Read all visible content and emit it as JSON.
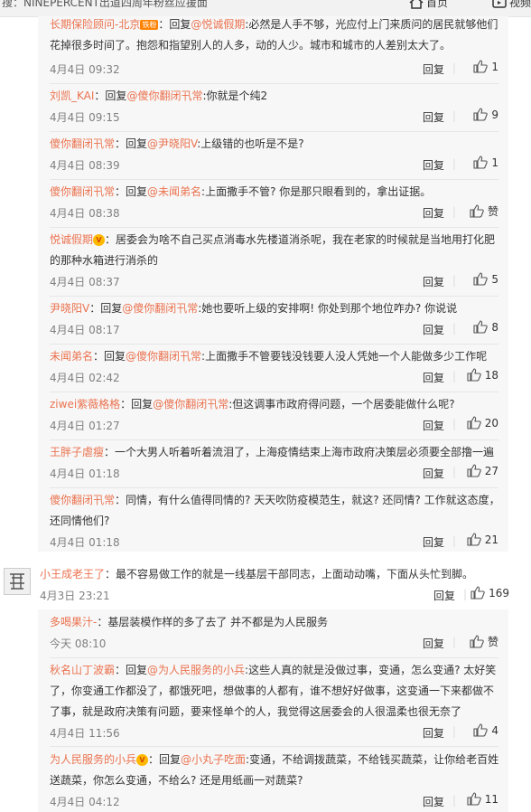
{
  "topbar": {
    "search": "搜：NINEPERCENT出道四周年粉丝应援面",
    "home": "首页",
    "video": "视频"
  },
  "thread1": [
    {
      "name": "长期保险顾问-北京",
      "badge": "铁粉",
      "prefix": "：回复",
      "mention": "@悦诚假期",
      "text": ":必然是人手不够，光应付上门来质问的居民就够他们花掉很多时间了。抱怨和指望别人的人多，动的人少。城市和城市的人差别太大了。",
      "time": "4月4日 09:32",
      "reply": "回复",
      "likes": "1"
    },
    {
      "name": "刘凯_KAI",
      "prefix": "：回复",
      "mention": "@傻你翻闭卂常",
      "text": ":你就是个纯2",
      "time": "4月4日 09:15",
      "reply": "回复",
      "likes": "9"
    },
    {
      "name": "傻你翻闭卂常",
      "prefix": "：回复",
      "mention": "@尹晓阳V",
      "text": ":上级错的也听是不是?",
      "time": "4月4日 08:39",
      "reply": "回复",
      "likes": "1"
    },
    {
      "name": "傻你翻闭卂常",
      "prefix": "：回复",
      "mention": "@未闻弟名",
      "text": ":上面撒手不管? 你是那只眼看到的，拿出证据。",
      "time": "4月4日 08:38",
      "reply": "回复",
      "likes": "赞"
    },
    {
      "name": "悦诚假期",
      "crown": "V",
      "prefix": "：",
      "mention": "",
      "text": "居委会为啥不自己买点消毒水先楼道消杀呢，我在老家的时候就是当地用打化肥的那种水箱进行消杀的",
      "time": "4月4日 08:37",
      "reply": "回复",
      "likes": "5"
    },
    {
      "name": "尹晓阳V",
      "prefix": "：回复",
      "mention": "@傻你翻闭卂常",
      "text": ":她也要听上级的安排啊! 你处到那个地位咋办? 你说说",
      "time": "4月4日 08:17",
      "reply": "回复",
      "likes": "8"
    },
    {
      "name": "未闻弟名",
      "prefix": "：回复",
      "mention": "@傻你翻闭卂常",
      "text": ":上面撒手不管要钱没钱要人没人凭她一个人能做多少工作呢",
      "time": "4月4日 02:42",
      "reply": "回复",
      "likes": "18"
    },
    {
      "name": "ziwei紫薇格格",
      "prefix": "：回复",
      "mention": "@傻你翻闭卂常",
      "text": ":但这调事市政府得问题，一个居委能做什么呢?",
      "time": "4月4日 01:27",
      "reply": "回复",
      "likes": "20"
    },
    {
      "name": "王胖子虐瘦",
      "prefix": "：",
      "mention": "",
      "text": "一个大男人听着听着流泪了，上海疫情结束上海市政府决策层必须要全部撸一遍",
      "time": "4月4日 01:18",
      "reply": "回复",
      "likes": "27"
    },
    {
      "name": "傻你翻闭卂常",
      "prefix": "：",
      "mention": "",
      "text": "同情，有什么值得同情的? 天天吹防疫模范生，就这? 还同情? 工作就这态度，还同情他们?",
      "time": "4月4日 01:18",
      "reply": "回复",
      "likes": "21"
    }
  ],
  "top_comment": {
    "name": "小王成老王了",
    "text": "：最不容易做工作的就是一线基层干部同志，上面动动嘴，下面从头忙到脚。",
    "time": "4月3日 23:21",
    "reply": "回复",
    "likes": "169"
  },
  "thread2": [
    {
      "name": "多喝果汁-",
      "prefix": "：",
      "mention": "",
      "text": "基层装模作样的多了去了 并不都是为人民服务",
      "time": "今天 08:10",
      "reply": "回复",
      "likes": "赞"
    },
    {
      "name": "秋名山丁波霸",
      "prefix": "：回复",
      "mention": "@为人民服务的小兵",
      "text": ":这些人真的就是没做过事，变通，怎么变通? 太好笑了，你变通工作都没了，都饿死吧，想做事的人都有，谁不想好好做事，这变通一下来都做不了事，就是政府决策有问题，要来怪单个的人，我觉得这居委会的人很温柔也很无奈了",
      "time": "4月4日 11:56",
      "reply": "回复",
      "likes": "4"
    },
    {
      "name": "为人民服务的小兵",
      "crown": "V",
      "prefix": "：回复",
      "mention": "@小丸子吃面",
      "text": ":变通，不给调拨蔬菜，不给钱买蔬菜，让你给老百姓送蔬菜，你怎么变通，不给么? 还是用纸画一对蔬菜?",
      "time": "4月4日 04:12",
      "reply": "回复",
      "likes": "11"
    }
  ]
}
